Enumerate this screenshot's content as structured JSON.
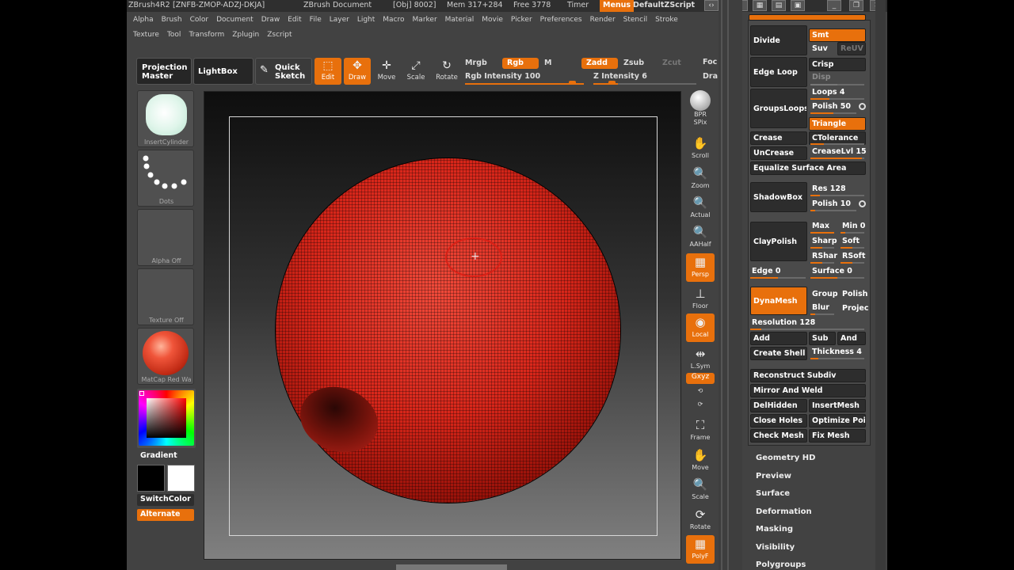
{
  "title_bar": {
    "app": "ZBrush4R2",
    "serial": "[ZNFB-ZMOP-ADZJ-DKJA]",
    "document": "ZBrush Document",
    "obj": "[Obj] 8002]",
    "mem": "Mem 317+284",
    "free": "Free 3778",
    "timer": "Timer",
    "menus": "Menus",
    "script": "DefaultZScript"
  },
  "menu_row1": [
    "Alpha",
    "Brush",
    "Color",
    "Document",
    "Draw",
    "Edit",
    "File",
    "Layer",
    "Light",
    "Macro",
    "Marker",
    "Material",
    "Movie",
    "Picker",
    "Preferences",
    "Render",
    "Stencil",
    "Stroke"
  ],
  "menu_row2": [
    "Texture",
    "Tool",
    "Transform",
    "Zplugin",
    "Zscript"
  ],
  "toolbar": {
    "projection_master": "Projection Master",
    "lightbox": "LightBox",
    "quick_sketch": "Quick Sketch",
    "edit": "Edit",
    "draw": "Draw",
    "move": "Move",
    "scale": "Scale",
    "rotate": "Rotate",
    "mrgb": "Mrgb",
    "rgb": "Rgb",
    "m": "M",
    "rgb_intensity": "Rgb Intensity 100",
    "zadd": "Zadd",
    "zsub": "Zsub",
    "zcut": "Zcut",
    "z_intensity": "Z Intensity 6",
    "foc": "Foc",
    "dra": "Dra"
  },
  "left_shelf": {
    "insert_cylinder": "InsertCylinder",
    "dots": "Dots",
    "alpha_off": "Alpha Off",
    "texture_off": "Texture Off",
    "matcap": "MatCap Red Wa",
    "gradient": "Gradient",
    "switch_color": "SwitchColor",
    "alternate": "Alternate"
  },
  "right_shelf": {
    "bpr": "BPR",
    "spix": "SPix",
    "scroll": "Scroll",
    "zoom": "Zoom",
    "actual": "Actual",
    "aahalf": "AAHalf",
    "persp": "Persp",
    "floor": "Floor",
    "local": "Local",
    "lsym": "L.Sym",
    "xyz": "Gxyz",
    "frame": "Frame",
    "move": "Move",
    "scale": "Scale",
    "rotate": "Rotate",
    "polyf": "PolyF"
  },
  "panel": {
    "divide": "Divide",
    "smt": "Smt",
    "suv": "Suv",
    "reuv": "ReUV",
    "edge_loop": "Edge Loop",
    "crisp": "Crisp",
    "disp": "Disp",
    "groups_loops": "GroupsLoops",
    "loops": "Loops 4",
    "polish50": "Polish 50",
    "triangle": "Triangle",
    "crease": "Crease",
    "ctolerance": "CTolerance",
    "uncrease": "UnCrease",
    "creaselvl": "CreaseLvl 15",
    "equalize": "Equalize Surface Area",
    "shadowbox": "ShadowBox",
    "res": "Res 128",
    "polish10": "Polish 10",
    "claypolish": "ClayPolish",
    "max": "Max",
    "min": "Min 0",
    "sharp": "Sharp",
    "soft": "Soft",
    "rshar": "RShar",
    "rsoft": "RSoft",
    "edge": "Edge 0",
    "surface": "Surface 0",
    "dynamesh": "DynaMesh",
    "group": "Group",
    "polish": "Polish",
    "blur": "Blur",
    "projec": "Projec",
    "resolution": "Resolution 128",
    "add": "Add",
    "sub": "Sub",
    "and": "And",
    "create_shell": "Create Shell",
    "thickness": "Thickness 4",
    "reconstruct": "Reconstruct Subdiv",
    "mirror_weld": "Mirror And Weld",
    "delhidden": "DelHidden",
    "insertmesh": "InsertMesh",
    "close_holes": "Close Holes",
    "optimize": "Optimize Poi",
    "check_mesh": "Check Mesh",
    "fix_mesh": "Fix Mesh"
  },
  "subpalettes": [
    "Geometry HD",
    "Preview",
    "Surface",
    "Deformation",
    "Masking",
    "Visibility",
    "Polygroups"
  ],
  "colors": {
    "accent": "#e8700c",
    "sphere": "#d8261a"
  }
}
